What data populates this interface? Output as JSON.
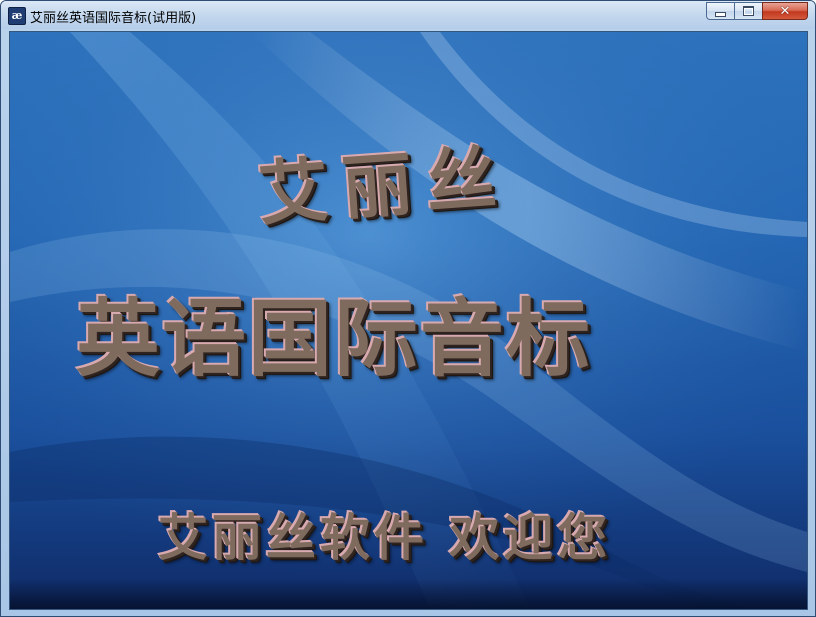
{
  "window": {
    "title": "艾丽丝英语国际音标(试用版)",
    "icon": "ae-logo-icon",
    "icon_glyph": "æ",
    "caption_buttons": {
      "minimize_icon": "minimize-icon",
      "maximize_icon": "maximize-icon",
      "close_icon": "close-icon",
      "close_glyph": "✕"
    }
  },
  "splash": {
    "line1": "艾丽丝",
    "line2": "英语国际音标",
    "line3": "艾丽丝软件  欢迎您"
  },
  "colors": {
    "background_top": "#2d72bd",
    "background_bottom": "#0f2a66",
    "text_face": "#7f6a5e",
    "text_highlight": "#d8aab0",
    "close_button": "#c2381f"
  }
}
